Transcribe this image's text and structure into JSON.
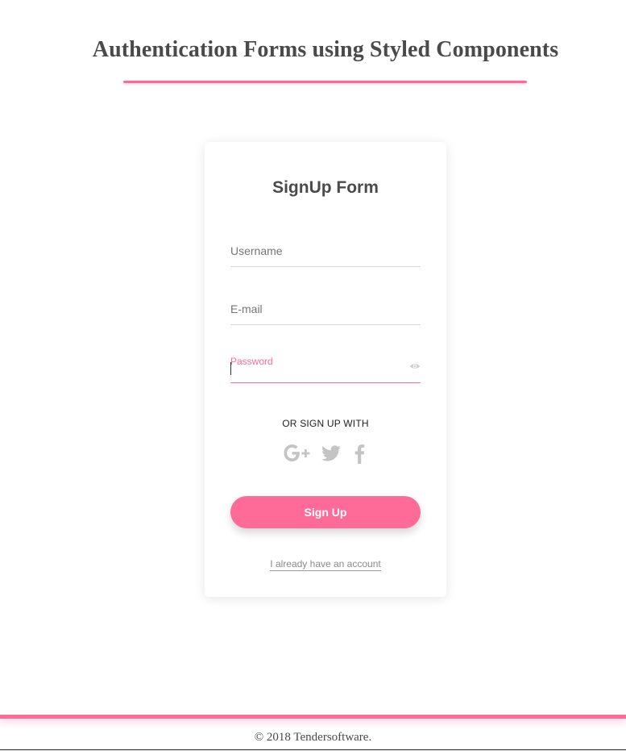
{
  "header": {
    "title": "Authentication Forms using Styled Components"
  },
  "form": {
    "title": "SignUp Form",
    "username": {
      "placeholder": "Username",
      "value": ""
    },
    "email": {
      "placeholder": "E-mail",
      "value": ""
    },
    "password": {
      "label": "Password",
      "value": "",
      "toggle_icon": "eye-icon"
    },
    "social_text": "OR SIGN UP WITH",
    "social_icons": [
      "google-plus-icon",
      "twitter-icon",
      "facebook-icon"
    ],
    "submit_label": "Sign Up",
    "account_link": "I already have an account"
  },
  "footer": {
    "text": "© 2018 Tendersoftware."
  },
  "colors": {
    "accent": "#ff6b98",
    "text": "#4a4a4a",
    "muted_icon": "#c4c4c4"
  }
}
